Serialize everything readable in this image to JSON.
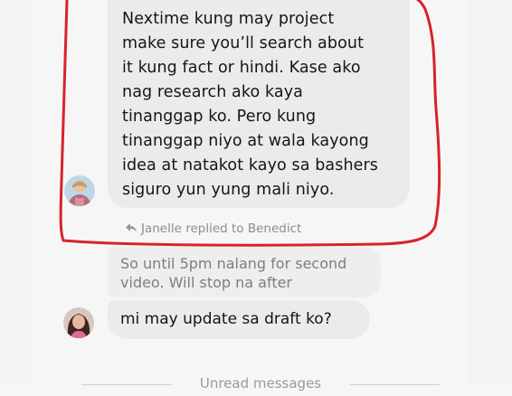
{
  "chat": {
    "message_main": "Nextime kung may project make sure you’ll search about it kung fact or hindi. Kase ako nag research ako kaya tinanggap ko. Pero kung tinanggap niyo at wala kayong idea at natakot kayo sa bashers siguro yun yung mali niyo.",
    "message_main_lines": [
      "Nextime kung may project",
      "make sure you’ll search about",
      "it kung fact or hindi. Kase ako",
      "nag research ako kaya",
      "tinanggap ko. Pero kung",
      "tinanggap niyo at wala kayong",
      "idea at natakot kayo sa bashers",
      "siguro yun yung mali niyo."
    ],
    "reply_indicator": "Janelle replied to Benedict",
    "message_faded_lines": [
      "So until 5pm nalang for second",
      "video. Will stop na after"
    ],
    "message_last": "mi may update sa draft ko?",
    "unread_divider": "Unread messages"
  },
  "icons": {
    "reply": "reply-arrow-icon"
  },
  "colors": {
    "annotation": "#d8232a",
    "bubble": "#ebebeb",
    "background": "#f6f6f6"
  }
}
